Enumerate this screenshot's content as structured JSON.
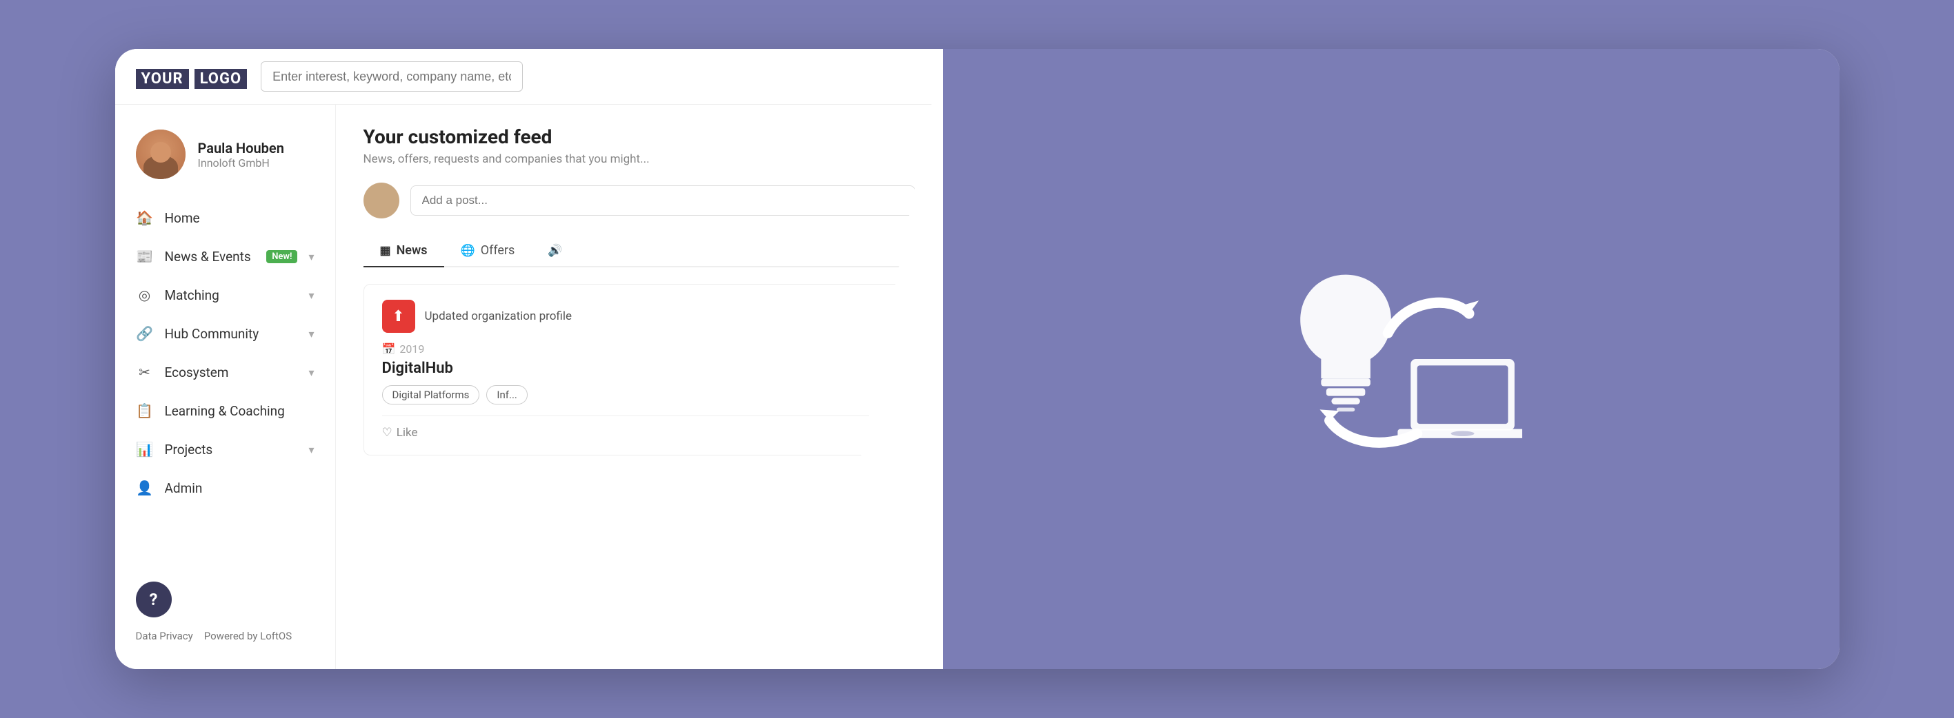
{
  "logo": {
    "your": "YOUR",
    "logo": "LOGO"
  },
  "search": {
    "placeholder": "Enter interest, keyword, company name, etc."
  },
  "user": {
    "name": "Paula Houben",
    "company": "Innoloft GmbH"
  },
  "nav": {
    "items": [
      {
        "id": "home",
        "label": "Home",
        "icon": "🏠",
        "badge": null,
        "chevron": false
      },
      {
        "id": "news-events",
        "label": "News & Events",
        "icon": "📰",
        "badge": "New!",
        "chevron": true
      },
      {
        "id": "matching",
        "label": "Matching",
        "icon": "🎯",
        "badge": null,
        "chevron": true
      },
      {
        "id": "hub-community",
        "label": "Hub Community",
        "icon": "🔗",
        "badge": null,
        "chevron": true
      },
      {
        "id": "ecosystem",
        "label": "Ecosystem",
        "icon": "✂",
        "badge": null,
        "chevron": true
      },
      {
        "id": "learning-coaching",
        "label": "Learning & Coaching",
        "icon": "📋",
        "badge": null,
        "chevron": false
      },
      {
        "id": "projects",
        "label": "Projects",
        "icon": "📊",
        "badge": null,
        "chevron": true
      },
      {
        "id": "admin",
        "label": "Admin",
        "icon": "👤",
        "badge": null,
        "chevron": false
      }
    ],
    "footer": {
      "data_privacy": "Data Privacy",
      "powered_by": "Powered by LoftOS"
    }
  },
  "feed": {
    "title": "Your customized feed",
    "subtitle": "News, offers, requests and companies that you might...",
    "post_placeholder": "Add a post...",
    "tabs": [
      {
        "id": "news",
        "label": "News",
        "icon": "📰"
      },
      {
        "id": "offers",
        "label": "Offers",
        "icon": "🌐"
      },
      {
        "id": "more",
        "label": "",
        "icon": "🔊"
      }
    ],
    "card": {
      "action": "Updated organization profile",
      "year": "2019",
      "company": "DigitalHub",
      "tags": [
        "Digital Platforms",
        "Inf..."
      ],
      "like": "Like"
    }
  },
  "help_button": "?",
  "colors": {
    "purple_bg": "#7b7db5",
    "dark_navy": "#3a3a5c",
    "red_accent": "#e53935",
    "green_badge": "#4caf50"
  }
}
